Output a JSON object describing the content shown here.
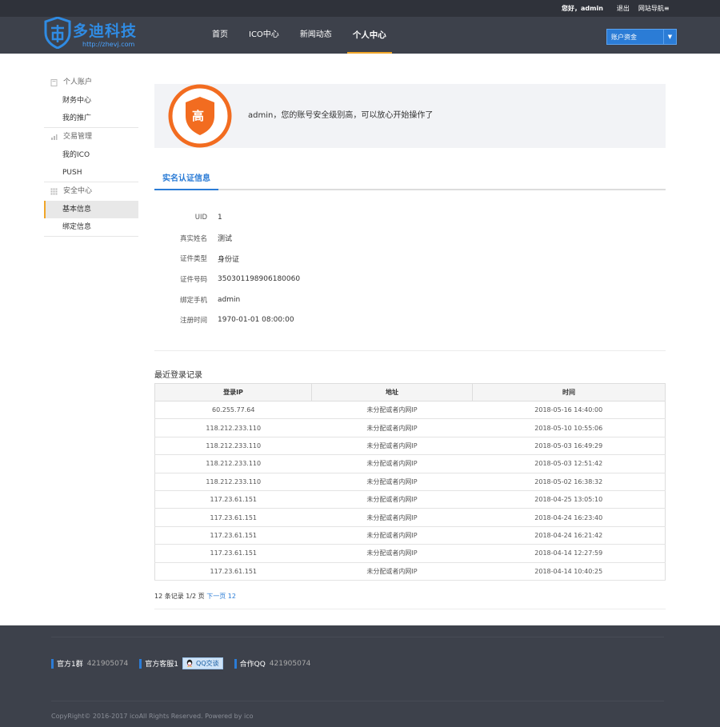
{
  "topbar": {
    "greeting": "您好，admin",
    "logout": "退出",
    "site_nav": "网站导航≡"
  },
  "logo": {
    "name": "多迪科技",
    "url": "http://zhevj.com"
  },
  "nav": {
    "items": [
      "首页",
      "ICO中心",
      "新闻动态",
      "个人中心"
    ],
    "active_index": 3
  },
  "account_select": {
    "value": "账户资金"
  },
  "sidebar": {
    "groups": [
      {
        "title": "个人账户",
        "icon": "document-icon",
        "items": [
          "财务中心",
          "我的推广"
        ]
      },
      {
        "title": "交易管理",
        "icon": "chart-icon",
        "items": [
          "我的ICO",
          "PUSH"
        ]
      },
      {
        "title": "安全中心",
        "icon": "grid-icon",
        "items": [
          "基本信息",
          "绑定信息"
        ]
      }
    ],
    "active_item": "基本信息"
  },
  "security": {
    "level": "高",
    "message": "admin，您的账号安全级别高，可以放心开始操作了"
  },
  "tab": {
    "label": "实名认证信息"
  },
  "info": [
    {
      "key": "UID",
      "value": "1"
    },
    {
      "key": "真实姓名",
      "value": "测试"
    },
    {
      "key": "证件类型",
      "value": "身份证"
    },
    {
      "key": "证件号码",
      "value": "350301198906180060"
    },
    {
      "key": "绑定手机",
      "value": "admin"
    },
    {
      "key": "注册时间",
      "value": "1970-01-01 08:00:00"
    }
  ],
  "login_log": {
    "title": "最近登录记录",
    "headers": [
      "登录IP",
      "地址",
      "时间"
    ],
    "rows": [
      [
        "60.255.77.64",
        "未分配或者内网IP",
        "2018-05-16 14:40:00"
      ],
      [
        "118.212.233.110",
        "未分配或者内网IP",
        "2018-05-10 10:55:06"
      ],
      [
        "118.212.233.110",
        "未分配或者内网IP",
        "2018-05-03 16:49:29"
      ],
      [
        "118.212.233.110",
        "未分配或者内网IP",
        "2018-05-03 12:51:42"
      ],
      [
        "118.212.233.110",
        "未分配或者内网IP",
        "2018-05-02 16:38:32"
      ],
      [
        "117.23.61.151",
        "未分配或者内网IP",
        "2018-04-25 13:05:10"
      ],
      [
        "117.23.61.151",
        "未分配或者内网IP",
        "2018-04-24 16:23:40"
      ],
      [
        "117.23.61.151",
        "未分配或者内网IP",
        "2018-04-24 16:21:42"
      ],
      [
        "117.23.61.151",
        "未分配或者内网IP",
        "2018-04-14 12:27:59"
      ],
      [
        "117.23.61.151",
        "未分配或者内网IP",
        "2018-04-14 10:40:25"
      ]
    ]
  },
  "pager": {
    "summary": "12 条记录 1/2 页",
    "next": "下一页",
    "last": "12"
  },
  "footer": {
    "group1_label": "官方1群",
    "group1_num": "421905074",
    "service_label": "官方客服1",
    "qq_button": "QQ交谈",
    "coop_label": "合作QQ",
    "coop_num": "421905074",
    "copyright": "CopyRight© 2016-2017 icoAll Rights Reserved. Powered by ico"
  },
  "colors": {
    "accent_blue": "#2b7cd6",
    "accent_orange": "#f0a628",
    "shield_orange": "#f26c20",
    "header_bg": "#3d414b"
  }
}
